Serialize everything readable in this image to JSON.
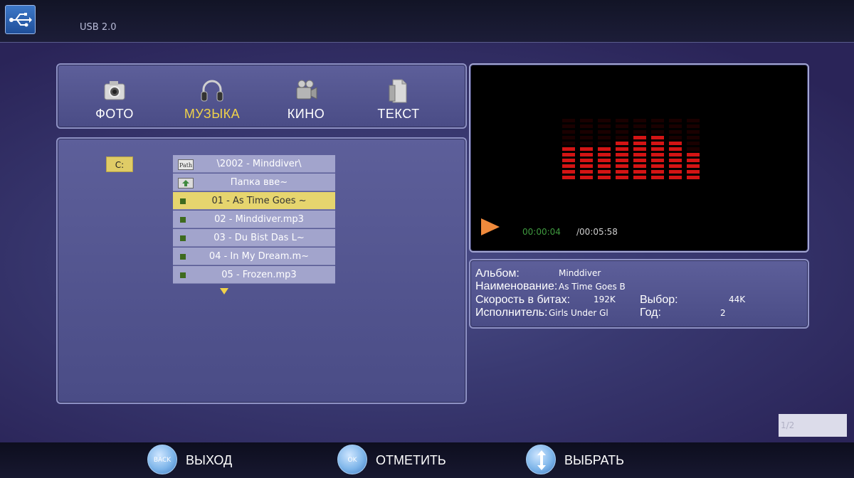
{
  "header": {
    "label": "USB 2.0",
    "logo_icon": "usb-icon"
  },
  "categories": [
    {
      "label": "ФОТО",
      "icon": "camera-icon",
      "active": false
    },
    {
      "label": "МУЗЫКА",
      "icon": "headphones-icon",
      "active": true
    },
    {
      "label": "КИНО",
      "icon": "video-camera-icon",
      "active": false
    },
    {
      "label": "ТЕКСТ",
      "icon": "document-icon",
      "active": false
    }
  ],
  "browser": {
    "drive": "C:",
    "rows": [
      {
        "label": "\\2002 - Minddiver\\",
        "kind": "path"
      },
      {
        "label": "Папка вве~",
        "kind": "up"
      },
      {
        "label": "01 - As Time Goes ~",
        "kind": "file",
        "selected": true
      },
      {
        "label": "02 - Minddiver.mp3",
        "kind": "file"
      },
      {
        "label": "03 - Du Bist Das L~",
        "kind": "file"
      },
      {
        "label": "04 - In My Dream.m~",
        "kind": "file"
      },
      {
        "label": "05 - Frozen.mp3",
        "kind": "file"
      }
    ]
  },
  "player": {
    "current_time": "00:00:04",
    "total_time": "/00:05:58",
    "equalizer_levels": [
      6,
      6,
      6,
      7,
      8,
      8,
      7,
      5
    ],
    "equalizer_max": 11,
    "colors": {
      "bar": "#d41414",
      "play": "#f08a3c"
    }
  },
  "info": {
    "album_label": "Альбом:",
    "album_value": "Minddiver",
    "title_label": "Наименование:",
    "title_value": "As Time Goes B",
    "bitrate_label": "Скорость в битах:",
    "bitrate_value": "192K",
    "sample_label": "Выбор:",
    "sample_value": "44K",
    "artist_label": "Исполнитель:",
    "artist_value": "Girls Under Gl",
    "year_label": "Год:",
    "year_value": "2"
  },
  "pager": "1/2",
  "footer": {
    "back_button": "BACK",
    "back_label": "ВЫХОД",
    "ok_button": "OK",
    "ok_label": "ОТМЕТИТЬ",
    "select_label": "ВЫБРАТЬ"
  }
}
